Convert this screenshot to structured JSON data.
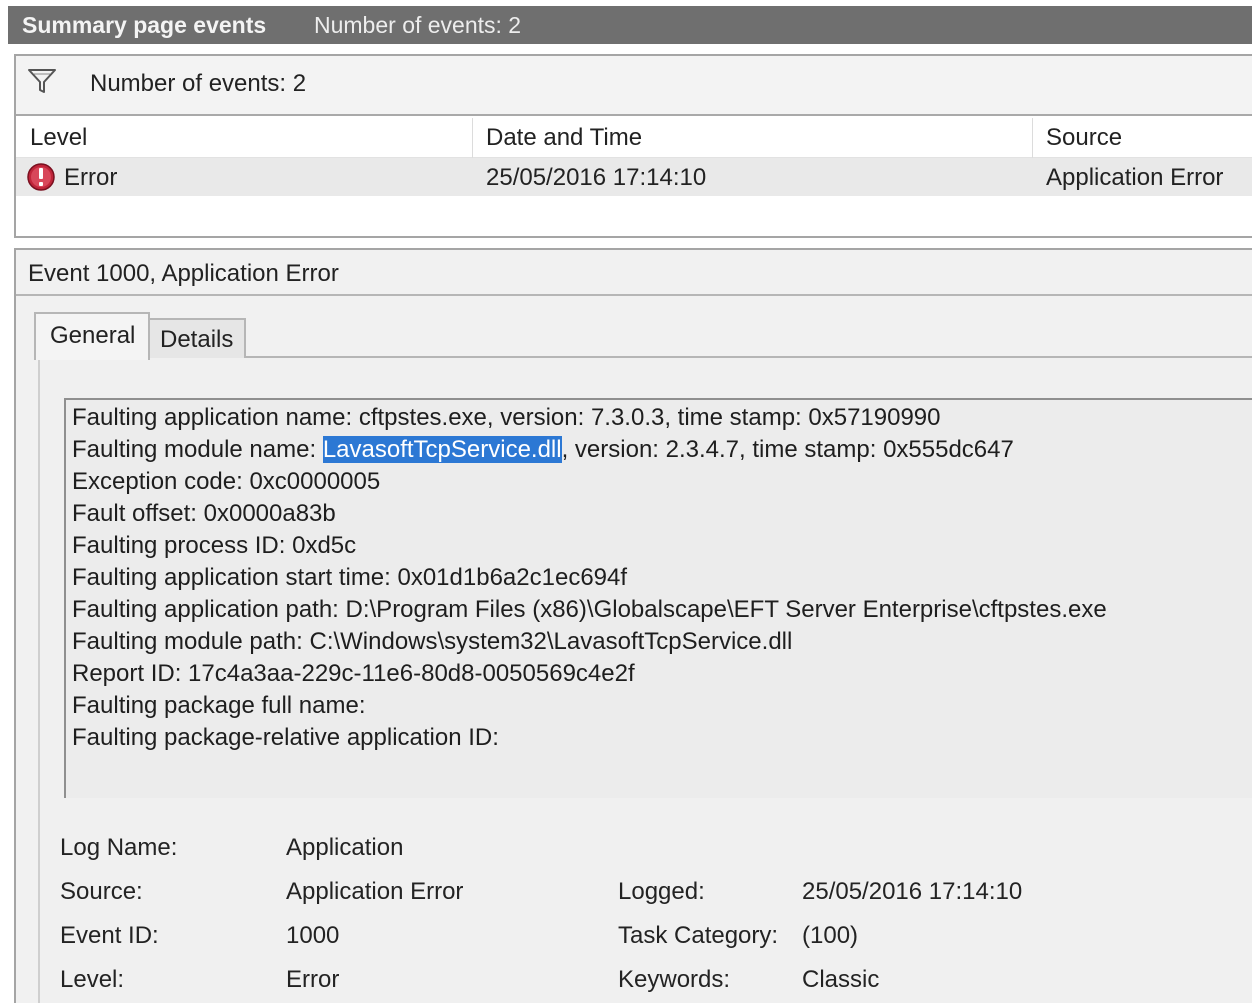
{
  "titlebar": {
    "title": "Summary page events",
    "subtitle": "Number of events: 2"
  },
  "filter": {
    "icon": "filter-icon",
    "text": "Number of events: 2"
  },
  "columns": {
    "level": "Level",
    "date_time": "Date and Time",
    "source": "Source"
  },
  "events": [
    {
      "level_icon": "error-icon",
      "level": "Error",
      "date_time": "25/05/2016 17:14:10",
      "source": "Application Error"
    }
  ],
  "detail": {
    "header": "Event 1000, Application Error",
    "tabs": {
      "general": "General",
      "details": "Details"
    },
    "description": {
      "line1": "Faulting application name: cftpstes.exe, version: 7.3.0.3, time stamp: 0x57190990",
      "line2_prefix": "Faulting module name: ",
      "line2_selected": "LavasoftTcpService.dll",
      "line2_suffix": ", version: 2.3.4.7, time stamp: 0x555dc647",
      "line3": "Exception code: 0xc0000005",
      "line4": "Fault offset: 0x0000a83b",
      "line5": "Faulting process ID: 0xd5c",
      "line6": "Faulting application start time: 0x01d1b6a2c1ec694f",
      "line7": "Faulting application path: D:\\Program Files (x86)\\Globalscape\\EFT Server Enterprise\\cftpstes.exe",
      "line8": "Faulting module path: C:\\Windows\\system32\\LavasoftTcpService.dll",
      "line9": "Report ID: 17c4a3aa-229c-11e6-80d8-0050569c4e2f",
      "line10": "Faulting package full name:",
      "line11": "Faulting package-relative application ID:"
    },
    "properties": {
      "log_name_label": "Log Name:",
      "log_name_value": "Application",
      "source_label": "Source:",
      "source_value": "Application Error",
      "logged_label": "Logged:",
      "logged_value": "25/05/2016 17:14:10",
      "event_id_label": "Event ID:",
      "event_id_value": "1000",
      "task_category_label": "Task Category:",
      "task_category_value": "(100)",
      "level_label": "Level:",
      "level_value": "Error",
      "keywords_label": "Keywords:",
      "keywords_value": "Classic"
    }
  },
  "colors": {
    "titlebar_bg": "#6f6f6f",
    "selection_highlight": "#2c78d4",
    "error_icon": "#c0253a"
  }
}
